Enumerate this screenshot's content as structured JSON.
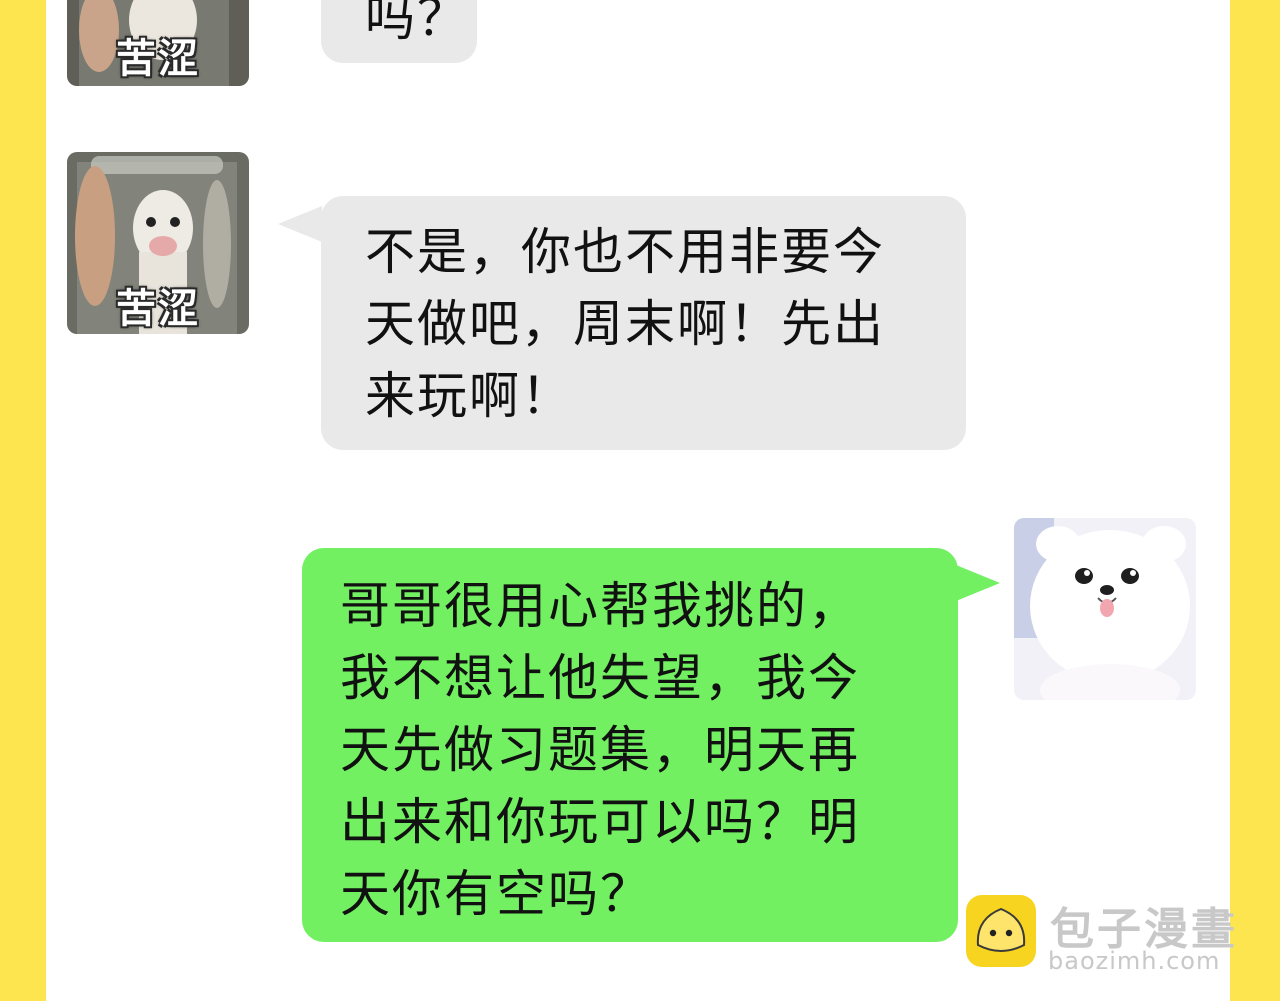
{
  "colors": {
    "stripe": "#fde54f",
    "gray_bubble": "#e9e9e9",
    "green_bubble": "#72f062",
    "watermark_text": "#c8c8c8"
  },
  "messages": [
    {
      "side": "left",
      "avatar_caption": "苦涩",
      "text": "吗？"
    },
    {
      "side": "left",
      "avatar_caption": "苦涩",
      "text": "不是，你也不用非要今\n天做吧，周末啊！先出\n来玩啊！"
    },
    {
      "side": "right",
      "avatar": "white-puppy-avatar",
      "text": "哥哥很用心帮我挑的，\n我不想让他失望，我今\n天先做习题集，明天再\n出来和你玩可以吗？明\n天你有空吗？"
    }
  ],
  "watermark": {
    "title": "包子漫畫",
    "url": "baozimh.com"
  }
}
